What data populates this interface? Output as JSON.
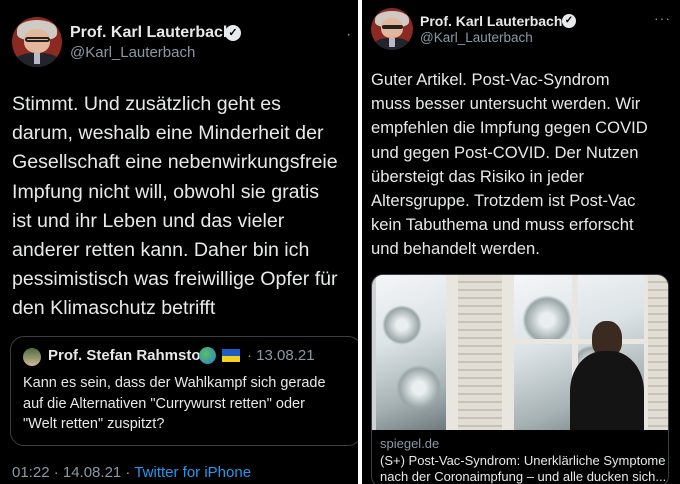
{
  "left_tweet": {
    "author_name": "Prof. Karl Lauterbach",
    "author_handle": "@Karl_Lauterbach",
    "verified_glyph": "✓",
    "more_glyph": "·",
    "text": "Stimmt. Und zusätzlich geht es\ndarum, weshalb eine Minderheit der\nGesellschaft eine nebenwirkungsfreie\nImpfung nicht will, obwohl sie gratis\nist und ihr Leben und das vieler\nanderer retten kann. Daher bin ich\npessimistisch was freiwillige Opfer für\nden Klimaschutz betrifft",
    "quote": {
      "author_name": "Prof. Stefan Rahmstorf",
      "date": "· 13.08.21",
      "text": "Kann es sein, dass der Wahlkampf sich gerade\nauf die Alternativen \"Currywurst retten\" oder\n\"Welt retten\" zuspitzt?"
    },
    "timestamp": "01:22 · 14.08.21 · ",
    "source": "Twitter for iPhone"
  },
  "right_tweet": {
    "author_name": "Prof. Karl Lauterbach",
    "author_handle": "@Karl_Lauterbach",
    "verified_glyph": "✓",
    "more_glyph": "···",
    "text": "Guter Artikel. Post-Vac-Syndrom\nmuss besser untersucht werden. Wir\nempfehlen die Impfung gegen COVID\nund gegen Post-COVID. Der Nutzen\nübersteigt das Risiko in jeder\nAltersgruppe. Trotzdem ist Post-Vac\nkein Tabuthema und muss erforscht\nund behandelt werden.",
    "card": {
      "domain": "spiegel.de",
      "title": "(S+) Post-Vac-Syndrom: Unerklärliche Symptome\nnach der Coronaimpfung – und alle ducken sich..."
    }
  },
  "colors": {
    "background": "#000000",
    "text": "#e7e9ea",
    "muted": "#8b98a5",
    "link": "#1d9bf0",
    "border": "#3a3f44"
  },
  "icons": [
    "verified-badge-icon",
    "globe-emoji-icon",
    "ukraine-flag-icon",
    "more-options-icon"
  ]
}
